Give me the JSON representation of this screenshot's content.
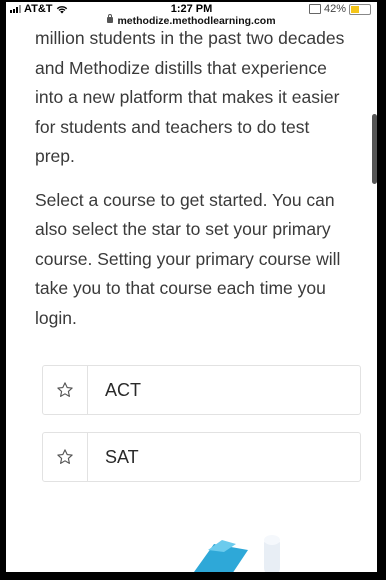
{
  "status": {
    "carrier": "AT&T",
    "time": "1:27 PM",
    "battery": "42%"
  },
  "url": "methodize.methodlearning.com",
  "main": {
    "paragraph1_lines": [
      "million students in the past two decades",
      "and Methodize distills that experience",
      "into a new platform that makes it easier",
      "for students and teachers to do test",
      "prep."
    ],
    "paragraph2_lines": [
      "Select a course to get started. You can",
      "also select the star to set your primary",
      "course. Setting your primary course will",
      "take you to that course each time you",
      "login."
    ],
    "courses": [
      {
        "label": "ACT",
        "icon": "star-outline-icon"
      },
      {
        "label": "SAT",
        "icon": "star-outline-icon"
      }
    ]
  },
  "colors": {
    "battery": "#f5c518",
    "text": "#3a3a3a",
    "border": "#e2e2e2"
  }
}
